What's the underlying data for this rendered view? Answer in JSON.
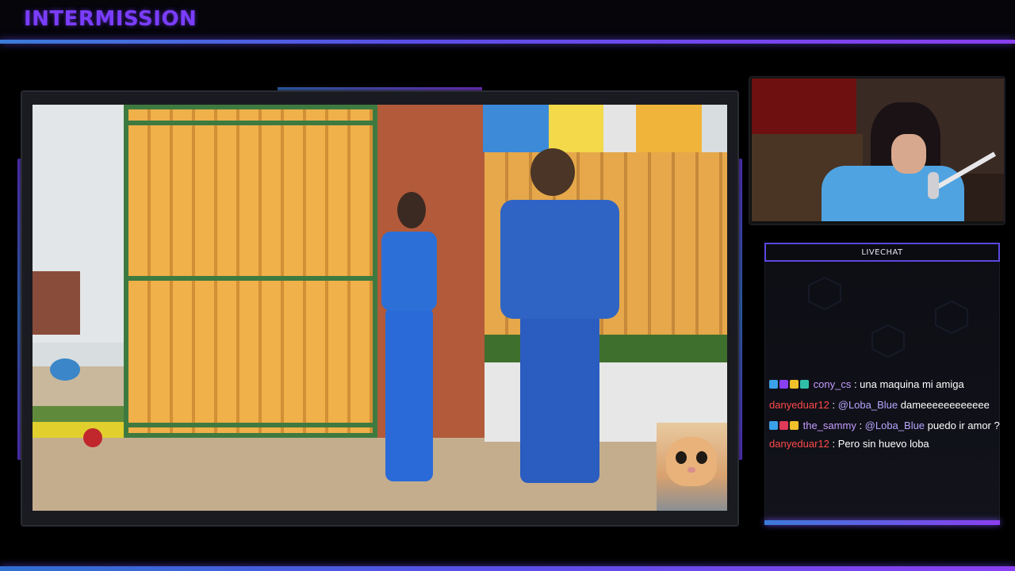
{
  "header": {
    "title": "INTERMISSION"
  },
  "chat": {
    "header_label": "LIVECHAT",
    "messages": [
      {
        "badges": [
          {
            "icon": "arrow-badge-icon",
            "color": "#3aa0e8"
          },
          {
            "icon": "heart-badge-icon",
            "color": "#8a3ff0"
          },
          {
            "icon": "one-badge-icon",
            "color": "#f0c02a"
          },
          {
            "icon": "gift-badge-icon",
            "color": "#2fbfa8"
          }
        ],
        "user": "cony_cs",
        "user_color": "#c59cff",
        "mention": "",
        "text": "una maquina mi amiga"
      },
      {
        "badges": [],
        "user": "danyeduar12",
        "user_color": "#ff4a4a",
        "mention": "@Loba_Blue",
        "text": "dameeeeeeeeeeee"
      },
      {
        "badges": [
          {
            "icon": "arrow-badge-icon",
            "color": "#3aa0e8"
          },
          {
            "icon": "heart-badge-icon",
            "color": "#e03a5a"
          },
          {
            "icon": "crown-badge-icon",
            "color": "#f0c02a"
          }
        ],
        "user": "the_sammy",
        "user_color": "#c59cff",
        "mention": "@Loba_Blue",
        "text": "puedo ir amor ?"
      },
      {
        "badges": [],
        "user": "danyeduar12",
        "user_color": "#ff4a4a",
        "mention": "",
        "text": "Pero sin huevo loba"
      }
    ]
  },
  "colors": {
    "accent_purple": "#7a3dff",
    "accent_blue": "#3b7bd8"
  }
}
